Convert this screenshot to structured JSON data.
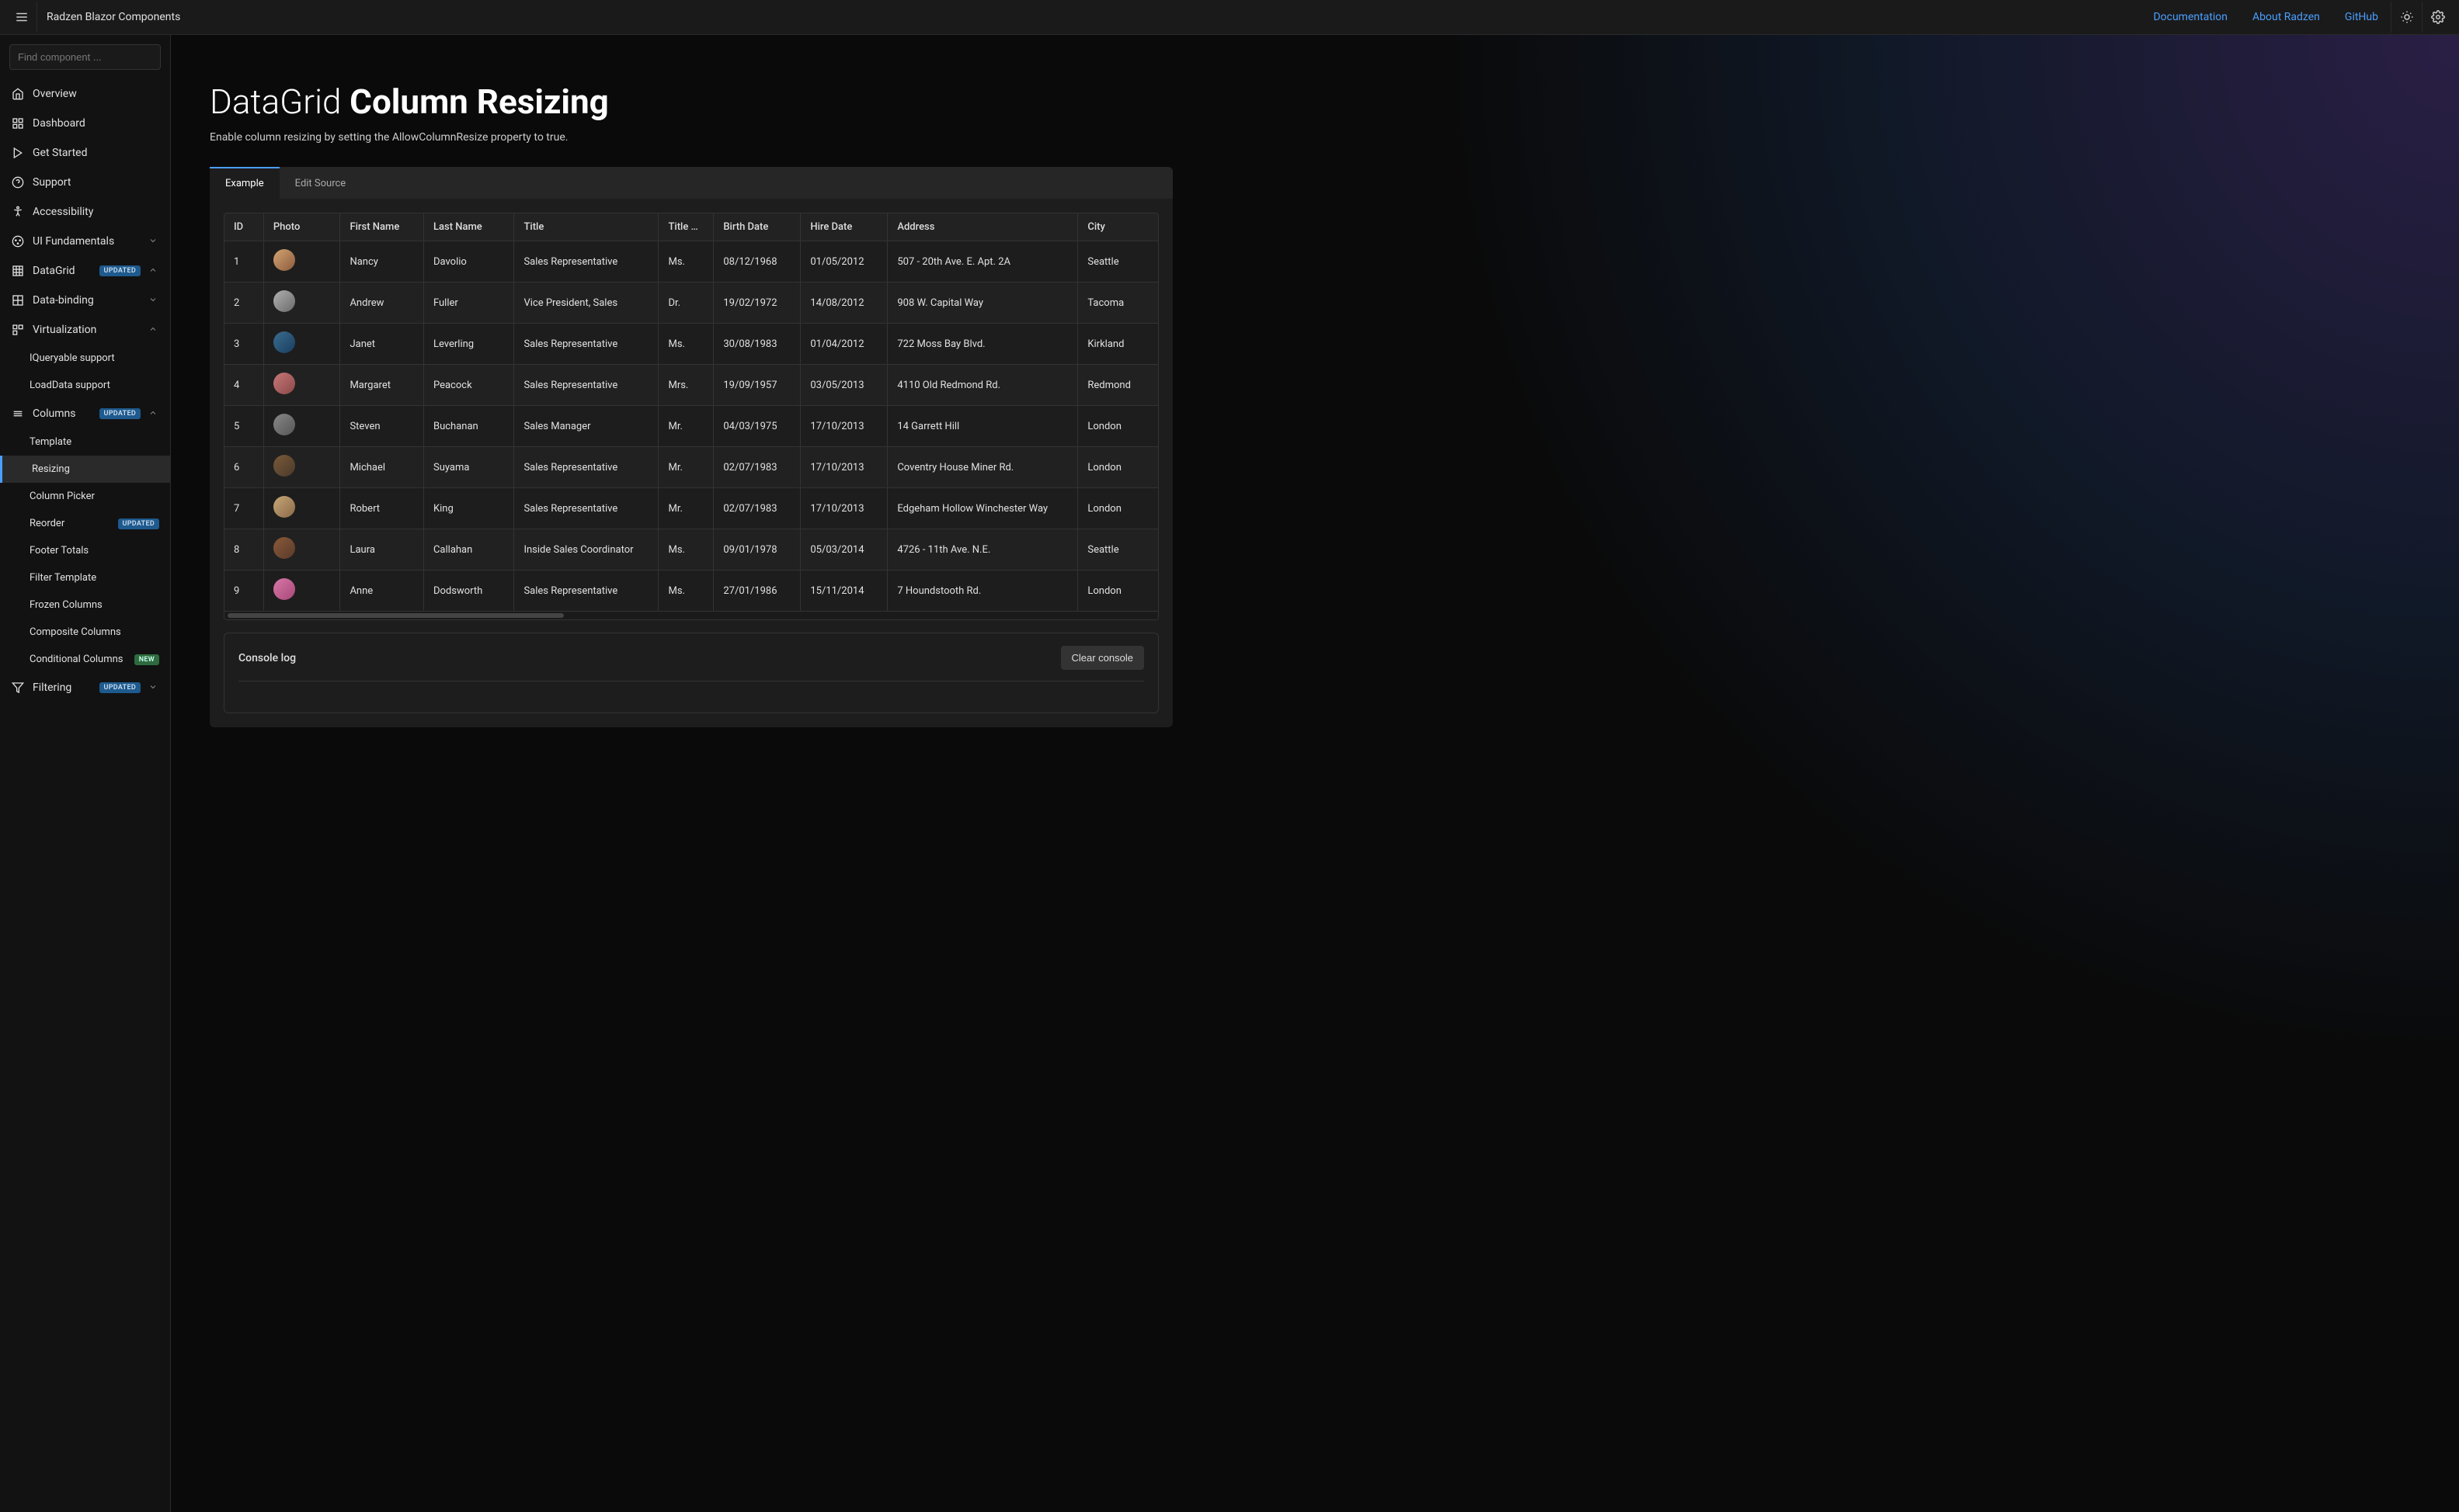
{
  "header": {
    "brand": "Radzen Blazor Components",
    "links": [
      "Documentation",
      "About Radzen",
      "GitHub"
    ]
  },
  "search": {
    "placeholder": "Find component ..."
  },
  "sidebar": {
    "top": [
      {
        "icon": "home",
        "label": "Overview"
      },
      {
        "icon": "dashboard",
        "label": "Dashboard"
      },
      {
        "icon": "play",
        "label": "Get Started"
      },
      {
        "icon": "help",
        "label": "Support"
      },
      {
        "icon": "accessibility",
        "label": "Accessibility"
      },
      {
        "icon": "palette",
        "label": "UI Fundamentals",
        "chevron": "down"
      }
    ],
    "datagrid": {
      "label": "DataGrid",
      "badge": "UPDATED"
    },
    "dg_items": [
      {
        "icon": "link",
        "label": "Data-binding",
        "chevron": "down"
      },
      {
        "icon": "virtual",
        "label": "Virtualization",
        "chevron": "up"
      }
    ],
    "virt_items": [
      {
        "label": "IQueryable support"
      },
      {
        "label": "LoadData support"
      }
    ],
    "columns": {
      "label": "Columns",
      "badge": "UPDATED"
    },
    "col_items": [
      {
        "label": "Template"
      },
      {
        "label": "Resizing",
        "active": true
      },
      {
        "label": "Column Picker"
      },
      {
        "label": "Reorder",
        "badge": "UPDATED"
      },
      {
        "label": "Footer Totals"
      },
      {
        "label": "Filter Template"
      },
      {
        "label": "Frozen Columns"
      },
      {
        "label": "Composite Columns"
      },
      {
        "label": "Conditional Columns",
        "badge": "NEW"
      }
    ],
    "filtering": {
      "label": "Filtering",
      "badge": "UPDATED"
    }
  },
  "page": {
    "title_light": "DataGrid ",
    "title_bold": "Column Resizing",
    "subtitle": "Enable column resizing by setting the AllowColumnResize property to true."
  },
  "tabs": [
    "Example",
    "Edit Source"
  ],
  "table": {
    "headers": [
      "ID",
      "Photo",
      "First Name",
      "Last Name",
      "Title",
      "Title …",
      "Birth Date",
      "Hire Date",
      "Address",
      "City"
    ],
    "rows": [
      {
        "id": "1",
        "fn": "Nancy",
        "ln": "Davolio",
        "title": "Sales Representative",
        "toc": "Ms.",
        "bd": "08/12/1968",
        "hd": "01/05/2012",
        "addr": "507 - 20th Ave. E. Apt. 2A",
        "city": "Seattle"
      },
      {
        "id": "2",
        "fn": "Andrew",
        "ln": "Fuller",
        "title": "Vice President, Sales",
        "toc": "Dr.",
        "bd": "19/02/1972",
        "hd": "14/08/2012",
        "addr": "908 W. Capital Way",
        "city": "Tacoma"
      },
      {
        "id": "3",
        "fn": "Janet",
        "ln": "Leverling",
        "title": "Sales Representative",
        "toc": "Ms.",
        "bd": "30/08/1983",
        "hd": "01/04/2012",
        "addr": "722 Moss Bay Blvd.",
        "city": "Kirkland"
      },
      {
        "id": "4",
        "fn": "Margaret",
        "ln": "Peacock",
        "title": "Sales Representative",
        "toc": "Mrs.",
        "bd": "19/09/1957",
        "hd": "03/05/2013",
        "addr": "4110 Old Redmond Rd.",
        "city": "Redmond"
      },
      {
        "id": "5",
        "fn": "Steven",
        "ln": "Buchanan",
        "title": "Sales Manager",
        "toc": "Mr.",
        "bd": "04/03/1975",
        "hd": "17/10/2013",
        "addr": "14 Garrett Hill",
        "city": "London"
      },
      {
        "id": "6",
        "fn": "Michael",
        "ln": "Suyama",
        "title": "Sales Representative",
        "toc": "Mr.",
        "bd": "02/07/1983",
        "hd": "17/10/2013",
        "addr": "Coventry House Miner Rd.",
        "city": "London"
      },
      {
        "id": "7",
        "fn": "Robert",
        "ln": "King",
        "title": "Sales Representative",
        "toc": "Mr.",
        "bd": "02/07/1983",
        "hd": "17/10/2013",
        "addr": "Edgeham Hollow Winchester Way",
        "city": "London"
      },
      {
        "id": "8",
        "fn": "Laura",
        "ln": "Callahan",
        "title": "Inside Sales Coordinator",
        "toc": "Ms.",
        "bd": "09/01/1978",
        "hd": "05/03/2014",
        "addr": "4726 - 11th Ave. N.E.",
        "city": "Seattle"
      },
      {
        "id": "9",
        "fn": "Anne",
        "ln": "Dodsworth",
        "title": "Sales Representative",
        "toc": "Ms.",
        "bd": "27/01/1986",
        "hd": "15/11/2014",
        "addr": "7 Houndstooth Rd.",
        "city": "London"
      }
    ]
  },
  "console": {
    "title": "Console log",
    "clear": "Clear console"
  }
}
